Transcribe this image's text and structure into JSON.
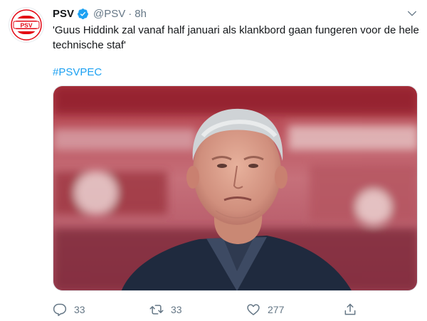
{
  "tweet": {
    "author_name": "PSV",
    "handle": "@PSV",
    "separator": "·",
    "time": "8h",
    "text": "'Guus Hiddink zal vanaf half januari als klankbord gaan fungeren voor de hele technische staf'",
    "hashtag": "#PSVPEC",
    "avatar_logo_text": "PSV",
    "media_description_icon": "photo",
    "stats": {
      "replies": "33",
      "retweets": "33",
      "likes": "277"
    }
  },
  "icons": {
    "verified": "verified-badge-icon",
    "caret": "chevron-down-icon",
    "reply": "reply-icon",
    "retweet": "retweet-icon",
    "like": "heart-icon",
    "share": "share-icon"
  },
  "colors": {
    "accent": "#1da1f2",
    "muted": "#657786",
    "psv_red": "#e30613"
  }
}
